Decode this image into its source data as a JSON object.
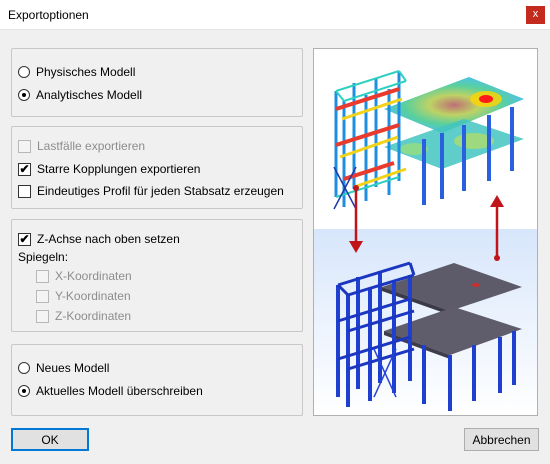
{
  "window": {
    "title": "Exportoptionen",
    "close_label": "x"
  },
  "model_type": {
    "options": [
      {
        "label": "Physisches Modell",
        "selected": false
      },
      {
        "label": "Analytisches Modell",
        "selected": true
      }
    ]
  },
  "export_options": {
    "items": [
      {
        "label": "Lastfälle exportieren",
        "checked": false,
        "enabled": false
      },
      {
        "label": "Starre Kopplungen exportieren",
        "checked": true,
        "enabled": true
      },
      {
        "label": "Eindeutiges Profil für jeden Stabsatz erzeugen",
        "checked": false,
        "enabled": true
      }
    ]
  },
  "axis": {
    "z_up_label": "Z-Achse nach oben setzen",
    "z_up_checked": true,
    "mirror_label": "Spiegeln:",
    "mirror_items": [
      {
        "label": "X-Koordinaten",
        "checked": false,
        "enabled": false
      },
      {
        "label": "Y-Koordinaten",
        "checked": false,
        "enabled": false
      },
      {
        "label": "Z-Koordinaten",
        "checked": false,
        "enabled": false
      }
    ]
  },
  "target": {
    "options": [
      {
        "label": "Neues Modell",
        "selected": false
      },
      {
        "label": "Aktuelles Modell überschreiben",
        "selected": true
      }
    ]
  },
  "buttons": {
    "ok": "OK",
    "cancel": "Abbrechen"
  },
  "colors": {
    "accent": "#0078d7",
    "close": "#c42b1c",
    "arrow": "#c0141a",
    "frame_blue": "#1f3fd0"
  },
  "check_glyph": "✔"
}
